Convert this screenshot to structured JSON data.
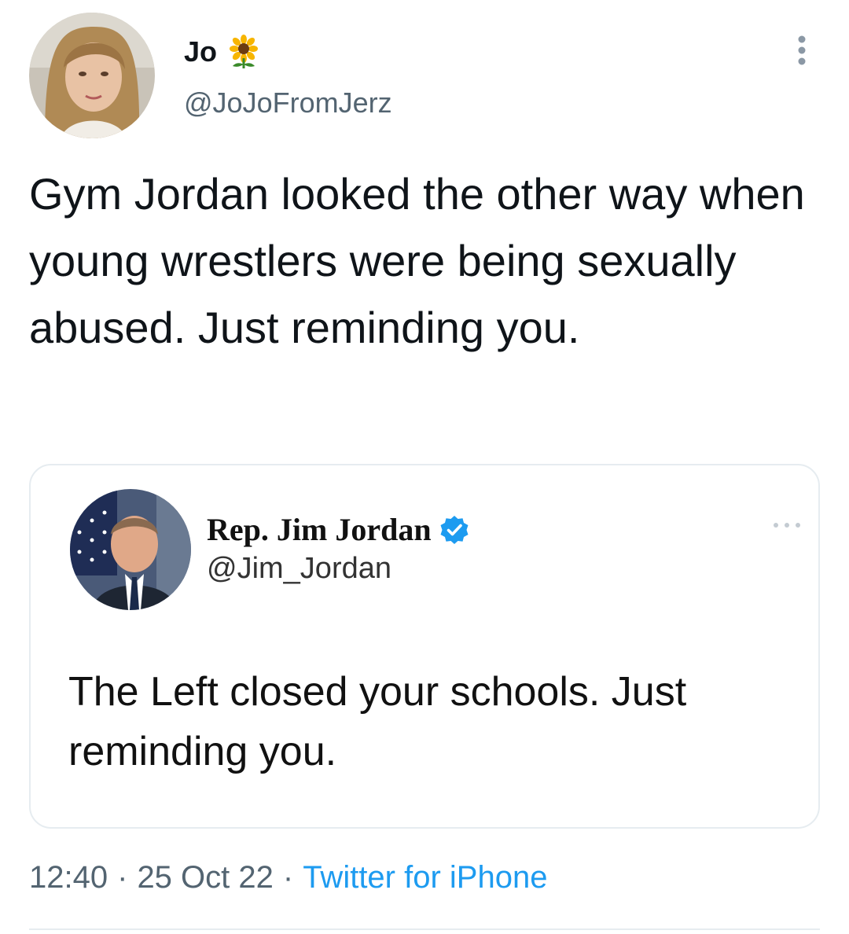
{
  "author": {
    "name": "Jo",
    "handle": "@JoJoFromJerz",
    "name_emoji_icon": "sunflower-icon"
  },
  "tweet": {
    "text": "Gym Jordan looked the other way when young wrestlers were being sexually abused. Just reminding you."
  },
  "quoted": {
    "name": "Rep. Jim Jordan",
    "handle": "@Jim_Jordan",
    "verified_icon": "verified-badge-icon",
    "text": "The Left closed your schools. Just reminding you."
  },
  "meta": {
    "time": "12:40",
    "separator": "·",
    "date": "25 Oct 22",
    "source": "Twitter for iPhone"
  },
  "colors": {
    "text": "#0f1419",
    "secondary": "#536471",
    "link": "#1d9bf0",
    "border": "#e6ecf0",
    "verified": "#1d9bf0"
  }
}
